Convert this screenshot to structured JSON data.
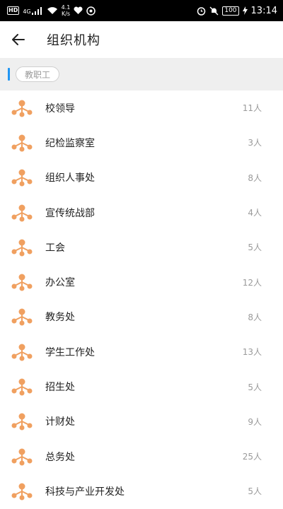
{
  "status_bar": {
    "hd": "HD",
    "signal": "4G",
    "net_speed_value": "4.1",
    "net_speed_unit": "K/s",
    "battery": "100",
    "time": "13:14"
  },
  "header": {
    "title": "组织机构",
    "back_icon": "arrow-left-icon"
  },
  "breadcrumb": {
    "chip": "教职工"
  },
  "colors": {
    "accent": "#2196f3",
    "icon_orange": "#f0a060"
  },
  "departments": [
    {
      "name": "校领导",
      "count": "11人"
    },
    {
      "name": "纪检监察室",
      "count": "3人"
    },
    {
      "name": "组织人事处",
      "count": "8人"
    },
    {
      "name": "宣传统战部",
      "count": "4人"
    },
    {
      "name": "工会",
      "count": "5人"
    },
    {
      "name": "办公室",
      "count": "12人"
    },
    {
      "name": "教务处",
      "count": "8人"
    },
    {
      "name": "学生工作处",
      "count": "13人"
    },
    {
      "name": "招生处",
      "count": "5人"
    },
    {
      "name": "计财处",
      "count": "9人"
    },
    {
      "name": "总务处",
      "count": "25人"
    },
    {
      "name": "科技与产业开发处",
      "count": "5人"
    }
  ]
}
